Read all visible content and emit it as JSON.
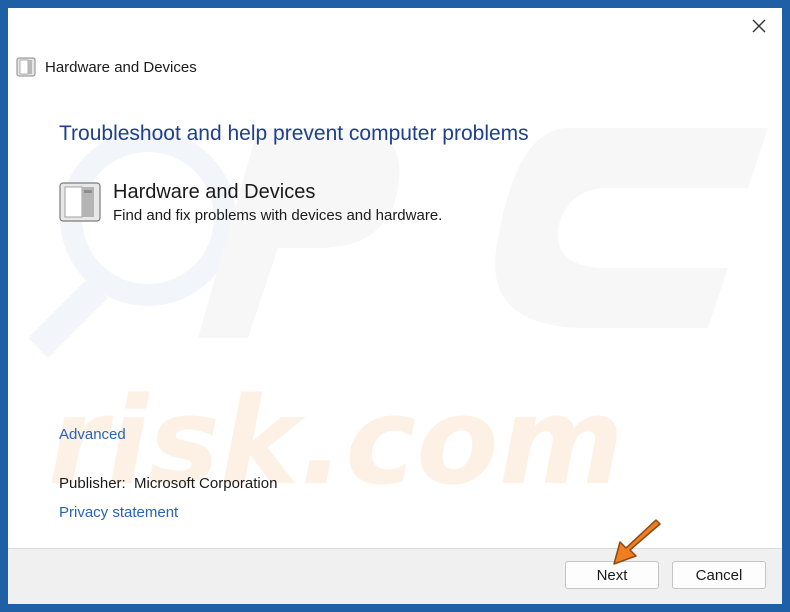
{
  "window": {
    "title": "Hardware and Devices",
    "close_icon": "close-icon"
  },
  "header_icon": "hardware-device-icon",
  "main": {
    "heading": "Troubleshoot and help prevent computer problems",
    "item": {
      "icon": "hardware-device-icon",
      "title": "Hardware and Devices",
      "description": "Find and fix problems with devices and hardware."
    },
    "advanced_link": "Advanced",
    "publisher_label": "Publisher:",
    "publisher_value": "Microsoft Corporation",
    "privacy_link": "Privacy statement"
  },
  "footer": {
    "next_label": "Next",
    "cancel_label": "Cancel"
  },
  "colors": {
    "frame": "#1f5fa6",
    "heading": "#1e3f8c",
    "link": "#2a63b5",
    "footer_bg": "#f0f0f0",
    "arrow": "#f07d22"
  }
}
